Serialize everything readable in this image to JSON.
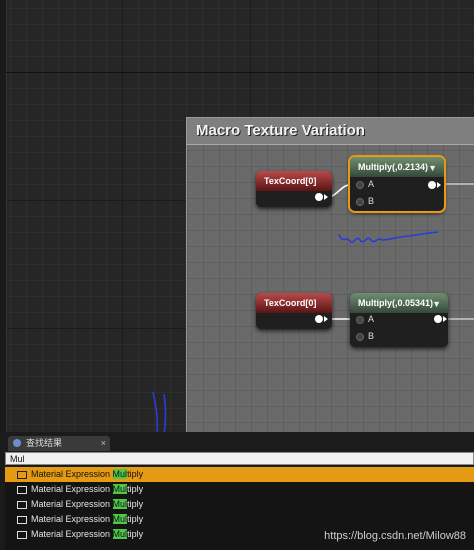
{
  "comment": {
    "title": "Macro Texture Variation"
  },
  "nodes": {
    "texcoord1": {
      "title": "TexCoord[0]"
    },
    "multiply1": {
      "title": "Multiply(,0.2134)",
      "pin_a": "A",
      "pin_b": "B"
    },
    "texcoord2": {
      "title": "TexCoord[0]"
    },
    "multiply2": {
      "title": "Multiply(,0.05341)",
      "pin_a": "A",
      "pin_b": "B"
    }
  },
  "panel": {
    "tab_label": "查找结果",
    "search_value": "Mul",
    "results": [
      {
        "prefix": "Material Expression ",
        "match": "Mul",
        "suffix": "tiply",
        "selected": true
      },
      {
        "prefix": "Material Expression ",
        "match": "Mul",
        "suffix": "tiply",
        "selected": false
      },
      {
        "prefix": "Material Expression ",
        "match": "Mul",
        "suffix": "tiply",
        "selected": false
      },
      {
        "prefix": "Material Expression ",
        "match": "Mul",
        "suffix": "tiply",
        "selected": false
      },
      {
        "prefix": "Material Expression ",
        "match": "Mul",
        "suffix": "tiply",
        "selected": false
      }
    ]
  },
  "watermark": "https://blog.csdn.net/Milow88",
  "colors": {
    "selection": "#e49a12",
    "highlight": "#4fc84a",
    "annotation": "#2a3cd8"
  }
}
